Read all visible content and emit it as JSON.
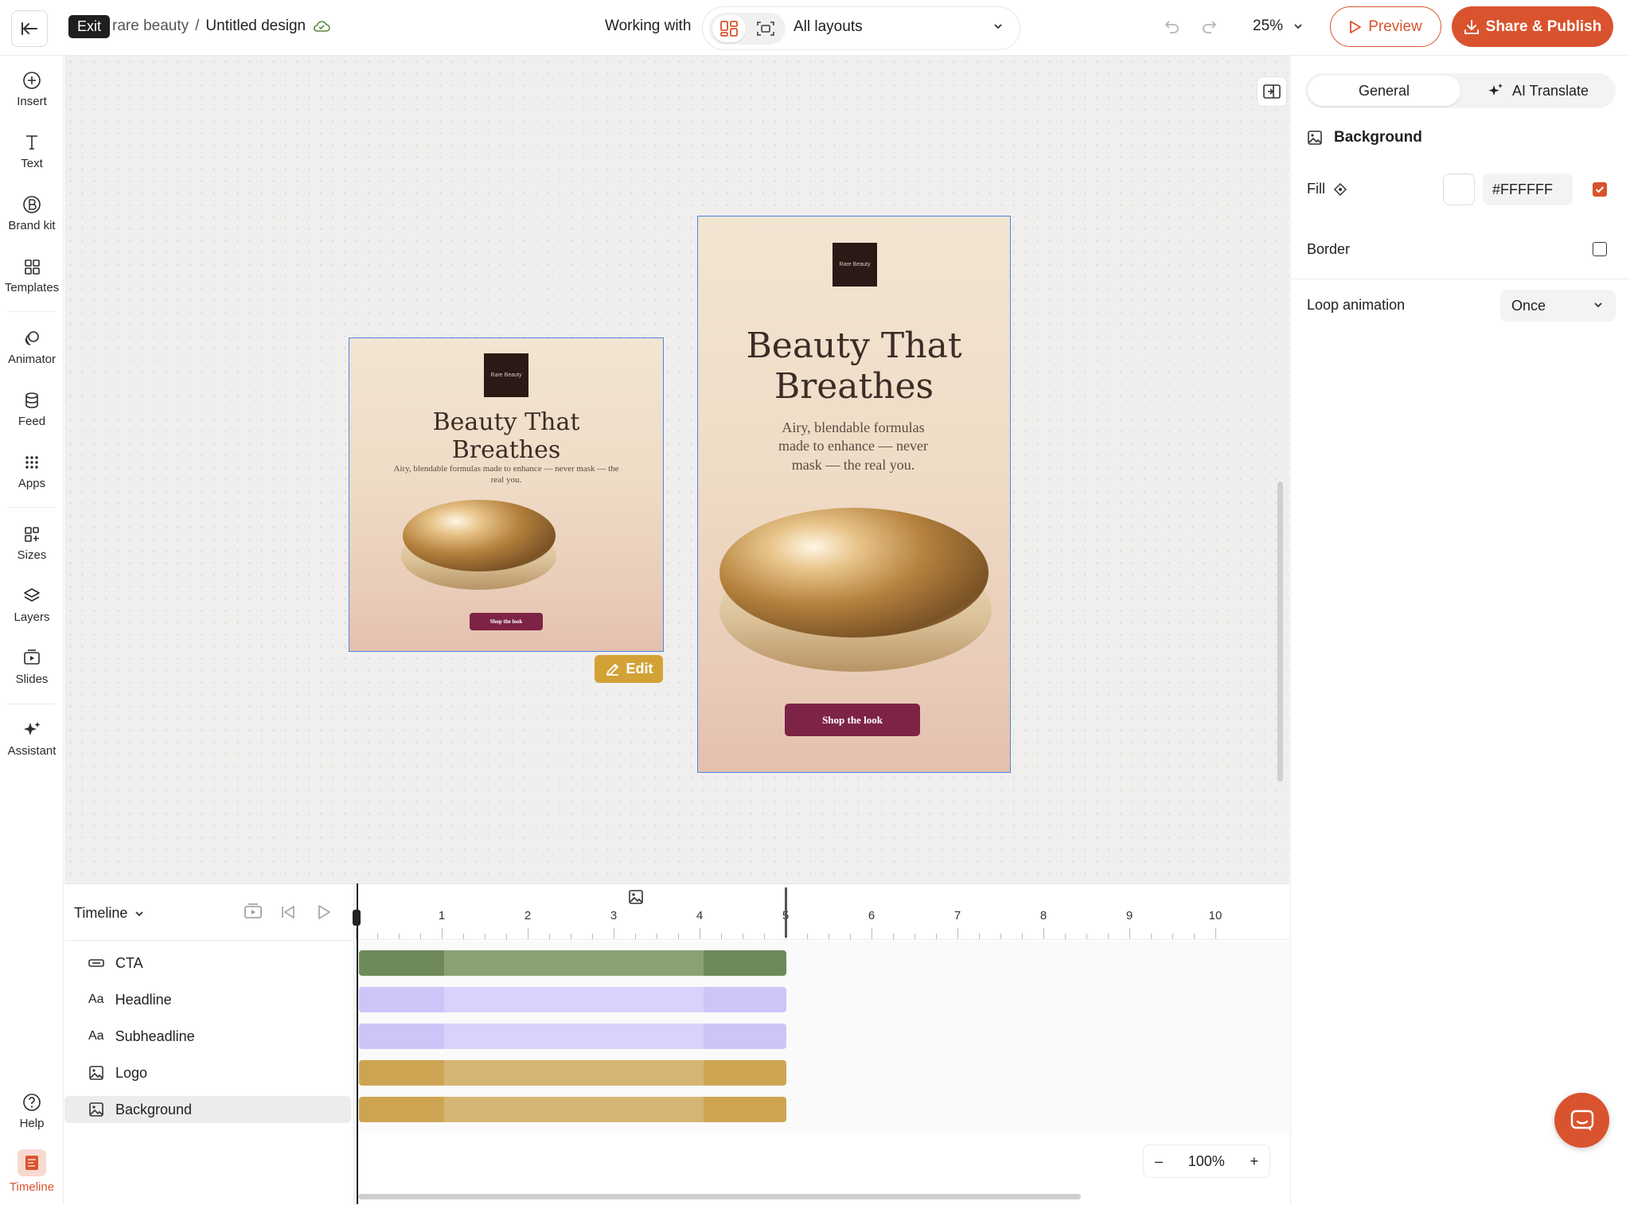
{
  "topbar": {
    "exit_label": "Exit",
    "breadcrumb_parent": "rare beauty",
    "breadcrumb_sep": "/",
    "breadcrumb_current": "Untitled design",
    "working_with": "Working with",
    "layout_select": "All layouts",
    "zoom": "25%",
    "preview_label": "Preview",
    "share_label": "Share & Publish",
    "accent_color": "#d9532e"
  },
  "leftnav": {
    "items": [
      {
        "label": "Insert",
        "icon": "plus-circle-icon"
      },
      {
        "label": "Text",
        "icon": "text-icon"
      },
      {
        "label": "Brand kit",
        "icon": "brand-kit-icon"
      },
      {
        "label": "Templates",
        "icon": "templates-icon"
      },
      {
        "label": "Animator",
        "icon": "animator-icon"
      },
      {
        "label": "Feed",
        "icon": "database-icon"
      },
      {
        "label": "Apps",
        "icon": "apps-grid-icon"
      },
      {
        "label": "Sizes",
        "icon": "sizes-icon"
      },
      {
        "label": "Layers",
        "icon": "layers-icon"
      },
      {
        "label": "Slides",
        "icon": "slides-icon"
      },
      {
        "label": "Assistant",
        "icon": "sparkle-icon"
      }
    ],
    "help_label": "Help",
    "timeline_label": "Timeline"
  },
  "canvas": {
    "square": {
      "logo": "Rare Beauty",
      "headline": "Beauty That Breathes",
      "subheadline": "Airy, blendable formulas made to enhance — never mask — the real you.",
      "cta": "Shop the look"
    },
    "portrait": {
      "logo": "Rare Beauty",
      "headline": "Beauty That Breathes",
      "subheadline": "Airy, blendable formulas made to enhance — never mask — the real you.",
      "cta": "Shop the look"
    },
    "edit_label": "Edit"
  },
  "rightpanel": {
    "tab_general": "General",
    "tab_translate": "AI Translate",
    "section_title": "Background",
    "fill_label": "Fill",
    "fill_hex": "#FFFFFF",
    "fill_enabled": true,
    "border_label": "Border",
    "border_enabled": false,
    "loop_label": "Loop animation",
    "loop_value": "Once"
  },
  "timeline": {
    "title": "Timeline",
    "ruler_ticks": [
      "1",
      "2",
      "3",
      "4",
      "5",
      "6",
      "7",
      "8",
      "9",
      "10"
    ],
    "layers": [
      {
        "name": "CTA",
        "icon": "button-icon",
        "color": "#8aa274",
        "edge_color": "#6e8a5a"
      },
      {
        "name": "Headline",
        "icon": "text-aa-icon",
        "color": "#d8d3fb",
        "edge_color": "#ccc5f7"
      },
      {
        "name": "Subheadline",
        "icon": "text-aa-icon",
        "color": "#d8d3fb",
        "edge_color": "#ccc5f7"
      },
      {
        "name": "Logo",
        "icon": "image-icon",
        "color": "#d6b574",
        "edge_color": "#cda552"
      },
      {
        "name": "Background",
        "icon": "image-icon",
        "color": "#d6b574",
        "edge_color": "#cda552"
      }
    ],
    "selected_layer": "Background",
    "zoom": "100%",
    "zoom_minus": "–",
    "zoom_plus": "+"
  }
}
